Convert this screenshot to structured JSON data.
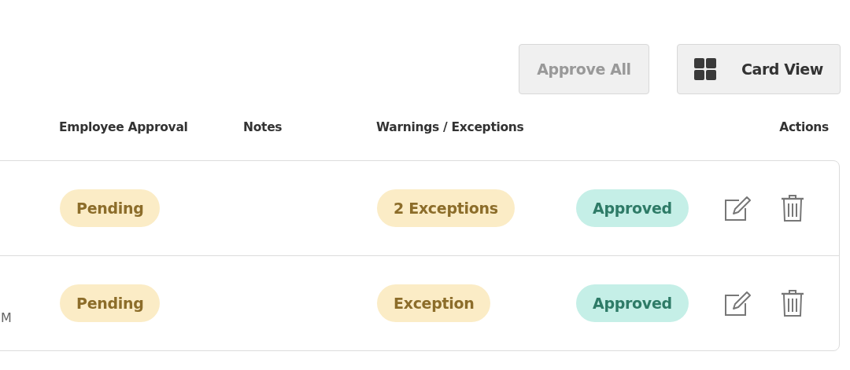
{
  "toolbar": {
    "buttons": [
      {
        "label": "Approve All",
        "kind": "text",
        "disabled": true
      },
      {
        "label": "Card View",
        "kind": "grid",
        "disabled": false
      }
    ]
  },
  "table": {
    "columns": [
      "Employee Approval",
      "Notes",
      "Warnings / Exceptions",
      "Actions"
    ],
    "rows": [
      {
        "employee_approval": {
          "label": "Pending",
          "kind": "pending"
        },
        "warnings": {
          "label": "2 Exceptions",
          "kind": "pending"
        },
        "status": {
          "label": "Approved",
          "kind": "approved"
        }
      },
      {
        "column_1": "M",
        "employee_approval": {
          "label": "Pending",
          "kind": "pending"
        },
        "warnings": {
          "label": "Exception",
          "kind": "pending"
        },
        "status": {
          "label": "Approved",
          "kind": "approved"
        }
      }
    ]
  }
}
